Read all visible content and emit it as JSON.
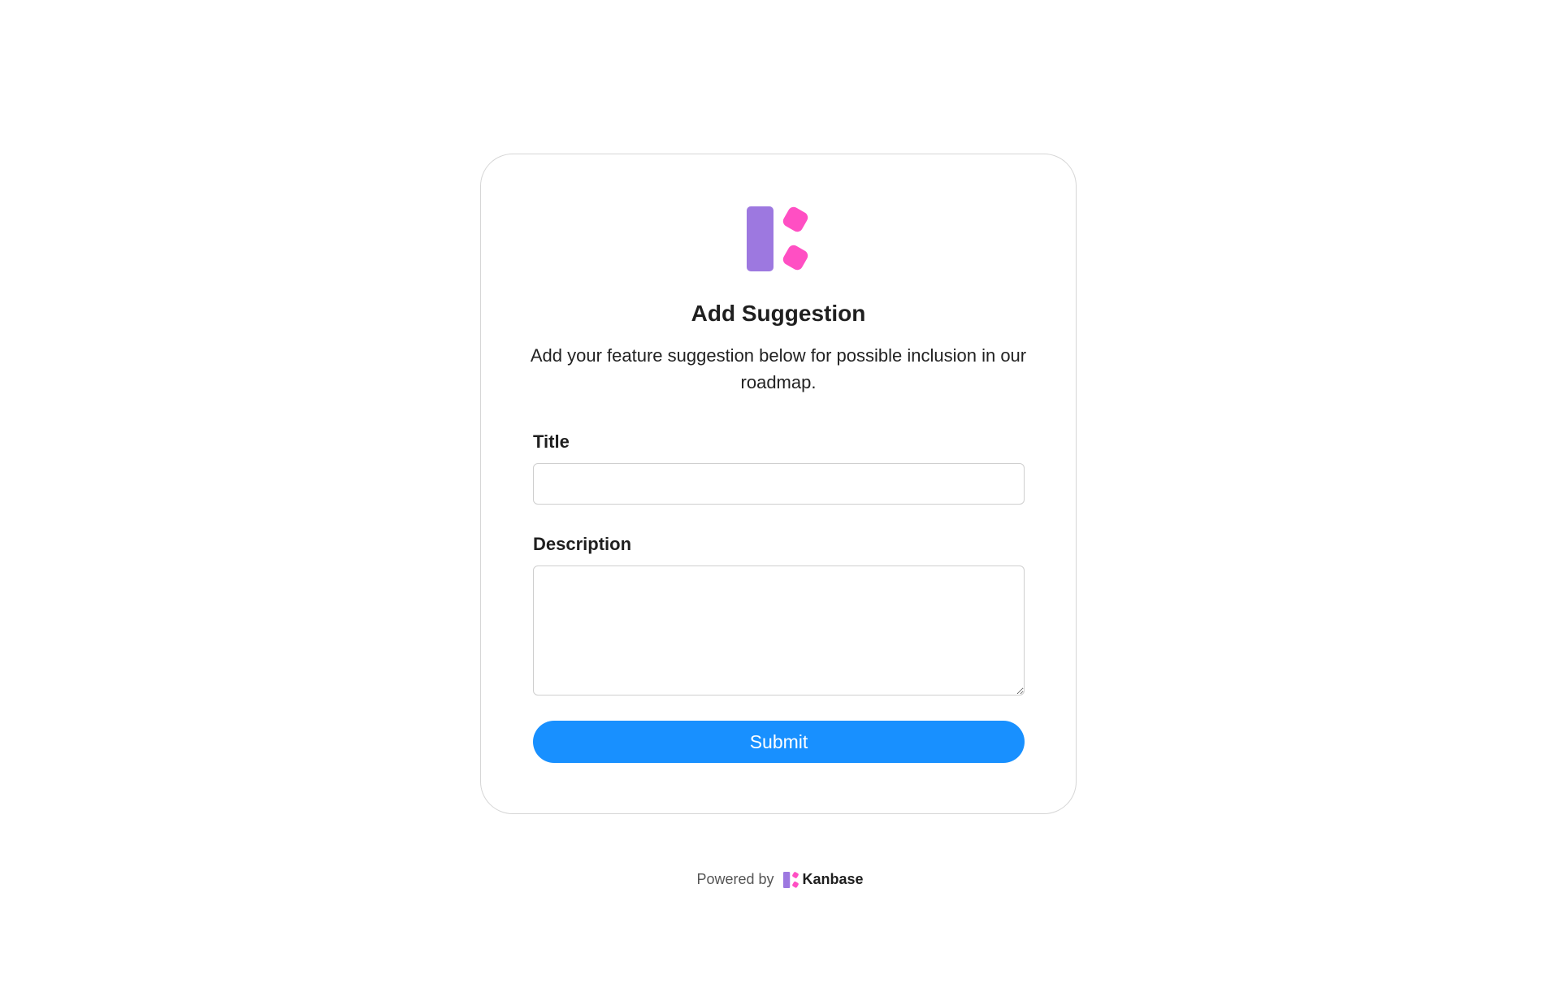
{
  "form": {
    "title": "Add Suggestion",
    "subtitle": "Add your feature suggestion below for possible inclusion in our roadmap.",
    "fields": {
      "title_label": "Title",
      "title_value": "",
      "description_label": "Description",
      "description_value": ""
    },
    "submit_label": "Submit"
  },
  "footer": {
    "powered_by": "Powered by",
    "brand": "Kanbase"
  },
  "icons": {
    "logo": "kanbase-logo-icon",
    "footer_logo": "kanbase-logo-icon"
  },
  "colors": {
    "logo_bar": "#9d78e0",
    "logo_squares": "#ff4fc3",
    "submit_bg": "#1890ff",
    "card_border": "#d6d6d6"
  }
}
